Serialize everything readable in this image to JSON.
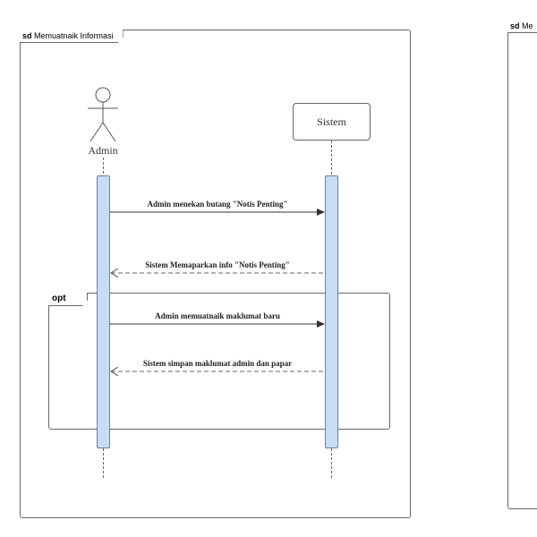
{
  "left_diagram": {
    "frame_label_kw": "sd",
    "frame_label_name": "Memuatnaik Informasi",
    "actor_name": "Admin",
    "system_name": "Sistem",
    "opt_label": "opt",
    "messages": [
      {
        "text": "Admin menekan butang \"Notis Penting\"",
        "kind": "sync"
      },
      {
        "text": "Sistem Memaparkan info \"Notis Penting\"",
        "kind": "return"
      },
      {
        "text": "Admin memuatnaik maklumat baru",
        "kind": "sync"
      },
      {
        "text": "Sistem simpan maklumat admin dan papar",
        "kind": "return"
      }
    ]
  },
  "right_diagram": {
    "frame_label_kw": "sd",
    "frame_label_name": "Me"
  }
}
